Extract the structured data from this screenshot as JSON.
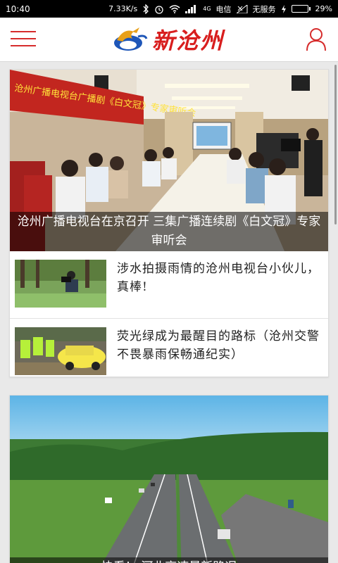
{
  "status_bar": {
    "time": "10:40",
    "speed": "7.33K/s",
    "carrier": "电信",
    "no_service": "无服务",
    "battery": "29%",
    "battery_level": 0.29,
    "signal_badge": "4G"
  },
  "header": {
    "logo_text": "新沧州",
    "menu_icon": "hamburger-menu-icon",
    "user_icon": "user-icon"
  },
  "feed": {
    "card1": {
      "hero": {
        "caption": "沧州广播电视台在京召开 三集广播连续剧《白文冠》专家审听会",
        "banner_text": "沧州广播电视台广播剧《白文冠》专家审听会"
      },
      "items": [
        {
          "title": "涉水拍摄雨情的沧州电视台小伙儿，真棒!"
        },
        {
          "title": "荧光绿成为最醒目的路标（沧州交警不畏暴雨保畅通纪实）"
        }
      ]
    },
    "card2": {
      "hero": {
        "caption": "快看！ 河北高速最新路况"
      }
    }
  },
  "colors": {
    "accent": "#d62c2c",
    "status_bg": "#000000"
  }
}
